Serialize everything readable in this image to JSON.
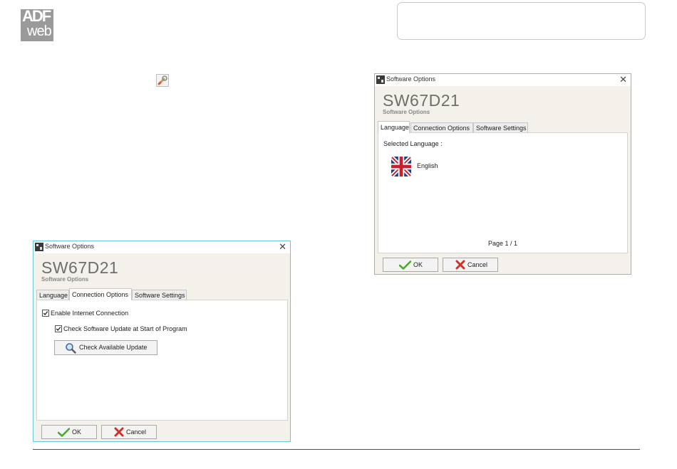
{
  "header": {
    "logo_text_top": "ADF",
    "logo_text_bottom": "web"
  },
  "dialog_language": {
    "window_title": "Software Options",
    "close_glyph": "✕",
    "product_name": "SW67D21",
    "subtitle": "Software Options",
    "tabs": [
      "Language",
      "Connection Options",
      "Software Settings"
    ],
    "active_tab": "Language",
    "selected_language_label": "Selected Language :",
    "language_name": "English",
    "language_flag": "uk-flag-icon",
    "page_indicator": "Page 1 / 1",
    "ok_label": "OK",
    "cancel_label": "Cancel"
  },
  "dialog_connection": {
    "window_title": "Software Options",
    "close_glyph": "✕",
    "product_name": "SW67D21",
    "subtitle": "Software Options",
    "tabs": [
      "Language",
      "Connection Options",
      "Software Settings"
    ],
    "active_tab": "Connection Options",
    "enable_internet_label": "Enable Internet Connection",
    "enable_internet_checked": true,
    "check_update_start_label": "Check Software Update at Start of Program",
    "check_update_start_checked": true,
    "check_available_update_label": "Check Available Update",
    "ok_label": "OK",
    "cancel_label": "Cancel"
  },
  "colors": {
    "dialog_border": "#6cc6da",
    "dialog_background": "#f4f1ea",
    "ok_check": "#4caa2a",
    "cancel_cross": "#d0302a",
    "footer_rule": "#2b5a8a"
  }
}
